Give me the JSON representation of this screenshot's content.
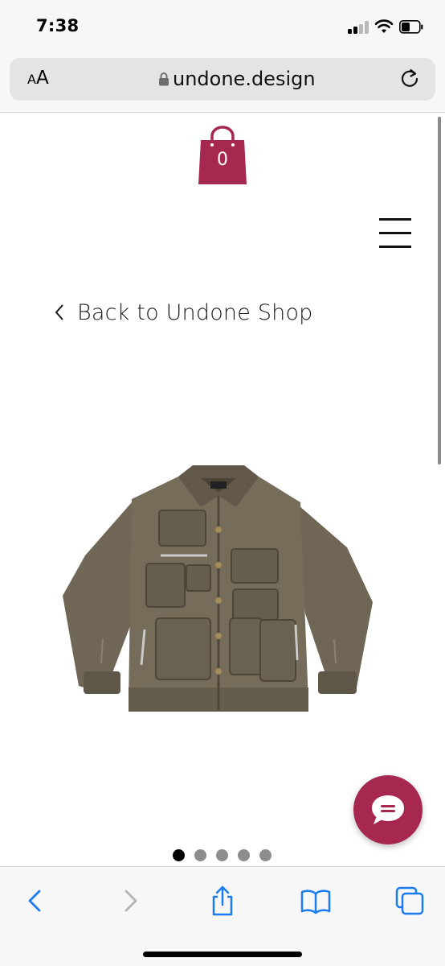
{
  "status_bar": {
    "time": "7:38",
    "signal_icon": "cellular-signal-icon",
    "wifi_icon": "wifi-icon",
    "battery_icon": "battery-icon"
  },
  "browser": {
    "text_size_label_small": "A",
    "text_size_label_large": "A",
    "lock_icon": "lock-icon",
    "url": "undone.design",
    "reload_icon": "reload-icon"
  },
  "page": {
    "cart_count": "0",
    "cart_icon": "shopping-bag-icon",
    "menu_icon": "hamburger-menu-icon",
    "back_link_label": "Back to Undone Shop",
    "product_image": "utility jacket with multiple cargo pockets",
    "gallery_dots": {
      "count": 5,
      "active_index": 0
    },
    "chat_icon": "chat-bubble-icon"
  },
  "toolbar": {
    "back_icon": "chevron-left-icon",
    "forward_icon": "chevron-right-icon",
    "share_icon": "share-icon",
    "bookmarks_icon": "book-icon",
    "tabs_icon": "tabs-icon"
  },
  "colors": {
    "brand": "#a6284f",
    "ios_blue": "#1a7cf5",
    "disabled_gray": "#b5b5b5"
  }
}
